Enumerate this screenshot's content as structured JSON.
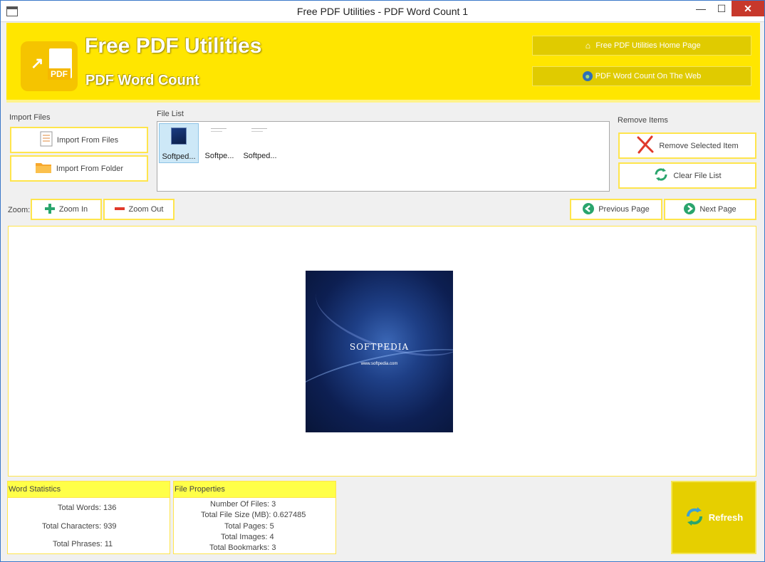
{
  "window": {
    "title": "Free PDF Utilities - PDF Word Count 1",
    "minimize": "—",
    "maximize": "☐",
    "close": "✕"
  },
  "header": {
    "brand_title": "Free PDF Utilities",
    "brand_subtitle": "PDF Word Count",
    "logo_text": "PDF",
    "home_link": "Free PDF Utilities Home Page",
    "web_link": "PDF Word Count On The Web"
  },
  "import": {
    "label": "Import Files",
    "from_files": "Import From Files",
    "from_folder": "Import From Folder"
  },
  "file_list": {
    "label": "File List",
    "items": [
      {
        "name": "Softped...",
        "selected": true
      },
      {
        "name": "Softpe...",
        "selected": false
      },
      {
        "name": "Softped...",
        "selected": false
      }
    ]
  },
  "remove": {
    "label": "Remove Items",
    "remove_selected": "Remove Selected Item",
    "clear_list": "Clear File List"
  },
  "zoom": {
    "label": "Zoom:",
    "zoom_in": "Zoom In",
    "zoom_out": "Zoom Out"
  },
  "paging": {
    "previous": "Previous Page",
    "next": "Next Page"
  },
  "preview": {
    "brand": "SOFTPEDIA",
    "url": "www.softpedia.com"
  },
  "word_stats": {
    "header": "Word Statistics",
    "total_words": "Total Words: 136",
    "total_characters": "Total Characters: 939",
    "total_phrases": "Total Phrases: 11"
  },
  "file_props": {
    "header": "File Properties",
    "number_of_files": "Number Of Files: 3",
    "total_file_size": "Total File Size (MB): 0.627485",
    "total_pages": "Total Pages: 5",
    "total_images": "Total Images: 4",
    "total_bookmarks": "Total Bookmarks: 3"
  },
  "refresh": {
    "label": "Refresh"
  },
  "colors": {
    "accent": "#ffe600",
    "accent_border": "#ffe54c",
    "title_blue": "#3b78c9"
  }
}
